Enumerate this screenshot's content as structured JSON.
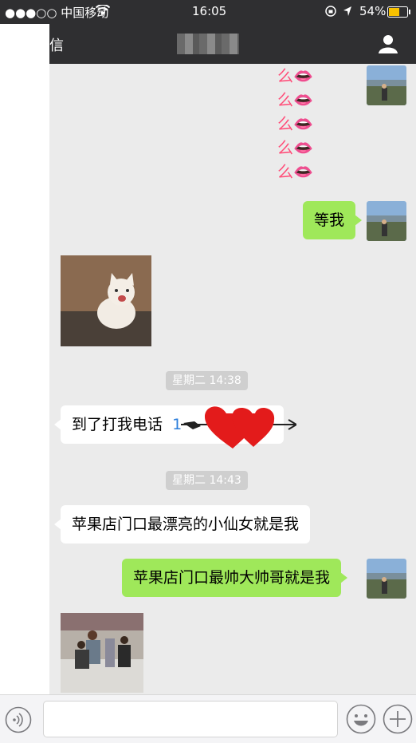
{
  "status": {
    "carrier": "●●●○○ 中国移动",
    "time": "16:05",
    "battery": "54%"
  },
  "nav": {
    "back_label": "信"
  },
  "chat": {
    "emoji_lines": [
      "么👄",
      "么👄",
      "么👄",
      "么👄",
      "么👄"
    ],
    "wait_me": "等我",
    "time1": "星期二 14:38",
    "call_me": "到了打我电话",
    "phone_partial": "1",
    "time2": "星期二 14:43",
    "fairy": "苹果店门口最漂亮的小仙女就是我",
    "handsome": "苹果店门口最帅大帅哥就是我"
  },
  "colors": {
    "green_bubble": "#9fe85a",
    "nav_bg": "#2f2f31",
    "chat_bg": "#ebebeb"
  }
}
